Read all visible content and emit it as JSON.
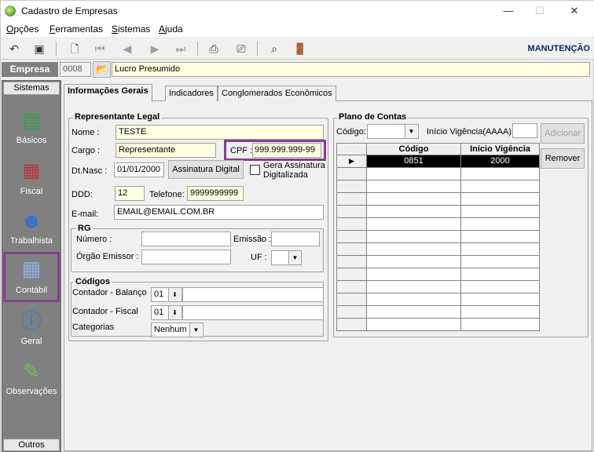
{
  "window": {
    "title": "Cadastro de Empresas",
    "minimize": "—",
    "maximize": "☐",
    "close": "✕"
  },
  "menu": [
    {
      "first": "O",
      "rest": "pções"
    },
    {
      "first": "F",
      "rest": "erramentas"
    },
    {
      "first": "S",
      "rest": "istemas"
    },
    {
      "first": "A",
      "rest": "juda"
    }
  ],
  "toolbar": {
    "mode": "MANUTENÇÃO"
  },
  "empresa": {
    "label": "Empresa",
    "code": "0008",
    "name": "Lucro Presumido"
  },
  "sidebar": {
    "header": "Sistemas",
    "items": [
      {
        "label": "Básicos",
        "icon": "binder-icon"
      },
      {
        "label": "Fiscal",
        "icon": "calculator-icon"
      },
      {
        "label": "Trabalhista",
        "icon": "worker-icon"
      },
      {
        "label": "Contábil",
        "icon": "calculator-icon"
      },
      {
        "label": "Geral",
        "icon": "info-icon"
      },
      {
        "label": "Observações",
        "icon": "notepad-icon"
      }
    ],
    "footer": "Outros"
  },
  "tabs": [
    "Informações Gerais",
    "Indicadores",
    "Conglomerados Econômicos"
  ],
  "representante": {
    "title": "Representante Legal",
    "nome_label": "Nome :",
    "nome": "TESTE",
    "cargo_label": "Cargo :",
    "cargo": "Representante",
    "cpf_label": "CPF :",
    "cpf": "999.999.999-99",
    "dtnasc_label": "Dt.Nasc :",
    "dtnasc": "01/01/2000",
    "assinatura_btn": "Assinatura Digital",
    "gera_assinatura": "Gera Assinatura Digitalizada",
    "ddd_label": "DDD:",
    "ddd": "12",
    "telefone_label": "Telefone:",
    "telefone": "9999999999",
    "email_label": "E-mail:",
    "email": "EMAIL@EMAIL.COM.BR"
  },
  "rg": {
    "title": "RG",
    "numero_label": "Número :",
    "numero": "",
    "emissao_label": "Emissão :",
    "emissao": "",
    "orgao_label": "Órgão Emissor :",
    "orgao": "",
    "uf_label": "UF :",
    "uf": ""
  },
  "codigos": {
    "title": "Códigos",
    "balanco_label": "Contador - Balanço",
    "balanco_code": "01",
    "balanco_name": "",
    "fiscal_label": "Contador - Fiscal",
    "fiscal_code": "01",
    "fiscal_name": "",
    "categorias_label": "Categorias",
    "categorias": "Nenhum"
  },
  "plano": {
    "title": "Plano de Contas",
    "codigo_label": "Código:",
    "codigo": "",
    "inicio_label": "Início Vigência(AAAA):",
    "inicio": "",
    "adicionar": "Adicionar",
    "remover": "Remover",
    "columns": [
      "Código",
      "Início Vigência"
    ],
    "rows": [
      {
        "codigo": "0851",
        "inicio": "2000"
      }
    ]
  }
}
